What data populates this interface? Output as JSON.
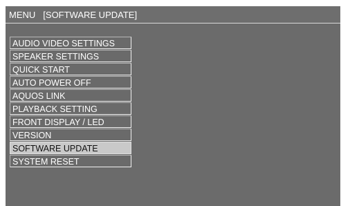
{
  "header": {
    "menu_label": "MENU",
    "current_section": "[SOFTWARE UPDATE]"
  },
  "menu": {
    "selected_index": 9,
    "items": [
      {
        "label": "AUDIO VIDEO SETTINGS"
      },
      {
        "label": "SPEAKER SETTINGS"
      },
      {
        "label": "QUICK START"
      },
      {
        "label": "AUTO POWER OFF"
      },
      {
        "label": "AQUOS LINK"
      },
      {
        "label": "PLAYBACK SETTING"
      },
      {
        "label": "FRONT DISPLAY / LED"
      },
      {
        "label": "VERSION"
      },
      {
        "label": "SOFTWARE UPDATE"
      },
      {
        "label": "SYSTEM RESET"
      }
    ]
  },
  "colors": {
    "background": "#6b6b6b",
    "highlight": "#c9c9c9",
    "text": "#ffffff"
  }
}
